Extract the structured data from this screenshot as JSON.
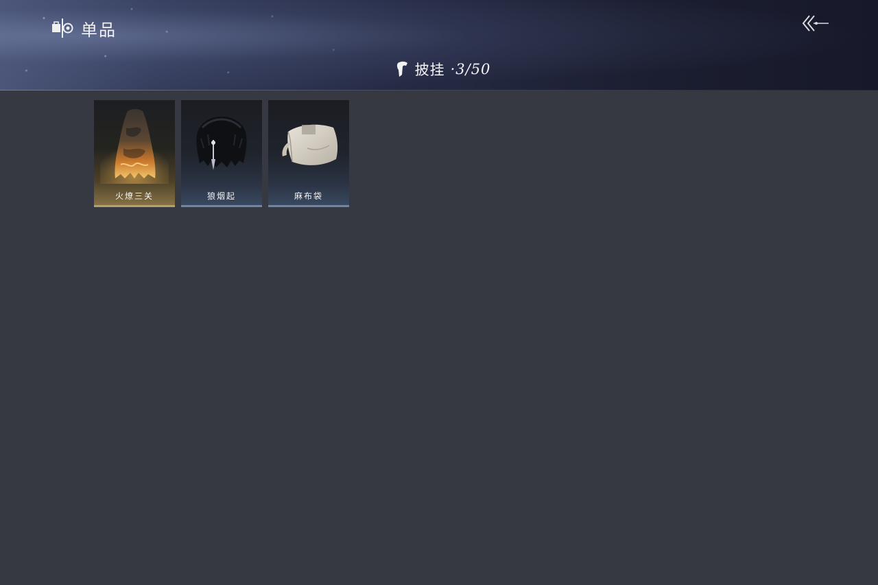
{
  "header": {
    "section_icon": "archive-icon",
    "section_label": "单品",
    "back_icon": "double-chevron-back-icon",
    "category": {
      "icon": "cape-icon",
      "label": "披挂",
      "count": "·3/50"
    }
  },
  "items": [
    {
      "name": "火燎三关",
      "icon": "flame-cape-icon",
      "rarity_color": "#b9a06a"
    },
    {
      "name": "狼烟起",
      "icon": "fur-cape-icon",
      "rarity_color": "#6e86a8"
    },
    {
      "name": "麻布袋",
      "icon": "linen-sack-icon",
      "rarity_color": "#6e86a8"
    }
  ]
}
